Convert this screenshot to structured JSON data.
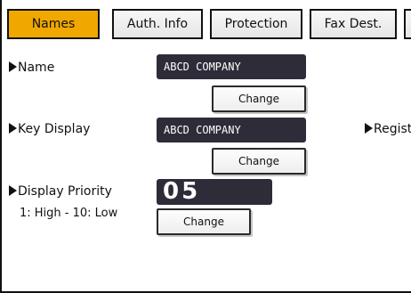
{
  "tabs": [
    {
      "label": "Names",
      "active": true
    },
    {
      "label": "Auth. Info",
      "active": false
    },
    {
      "label": "Protection",
      "active": false
    },
    {
      "label": "Fax Dest.",
      "active": false
    }
  ],
  "name": {
    "label": "Name",
    "value": "ABCD COMPANY",
    "button": "Change"
  },
  "key_display": {
    "label": "Key Display",
    "value": "ABCD COMPANY",
    "button": "Change"
  },
  "registration": {
    "label": "Regist"
  },
  "display_priority": {
    "label": "Display Priority",
    "hint": "1: High - 10: Low",
    "value": "05",
    "button": "Change"
  },
  "colors": {
    "active_tab": "#f0a800",
    "field_bg": "#2d2c38"
  }
}
